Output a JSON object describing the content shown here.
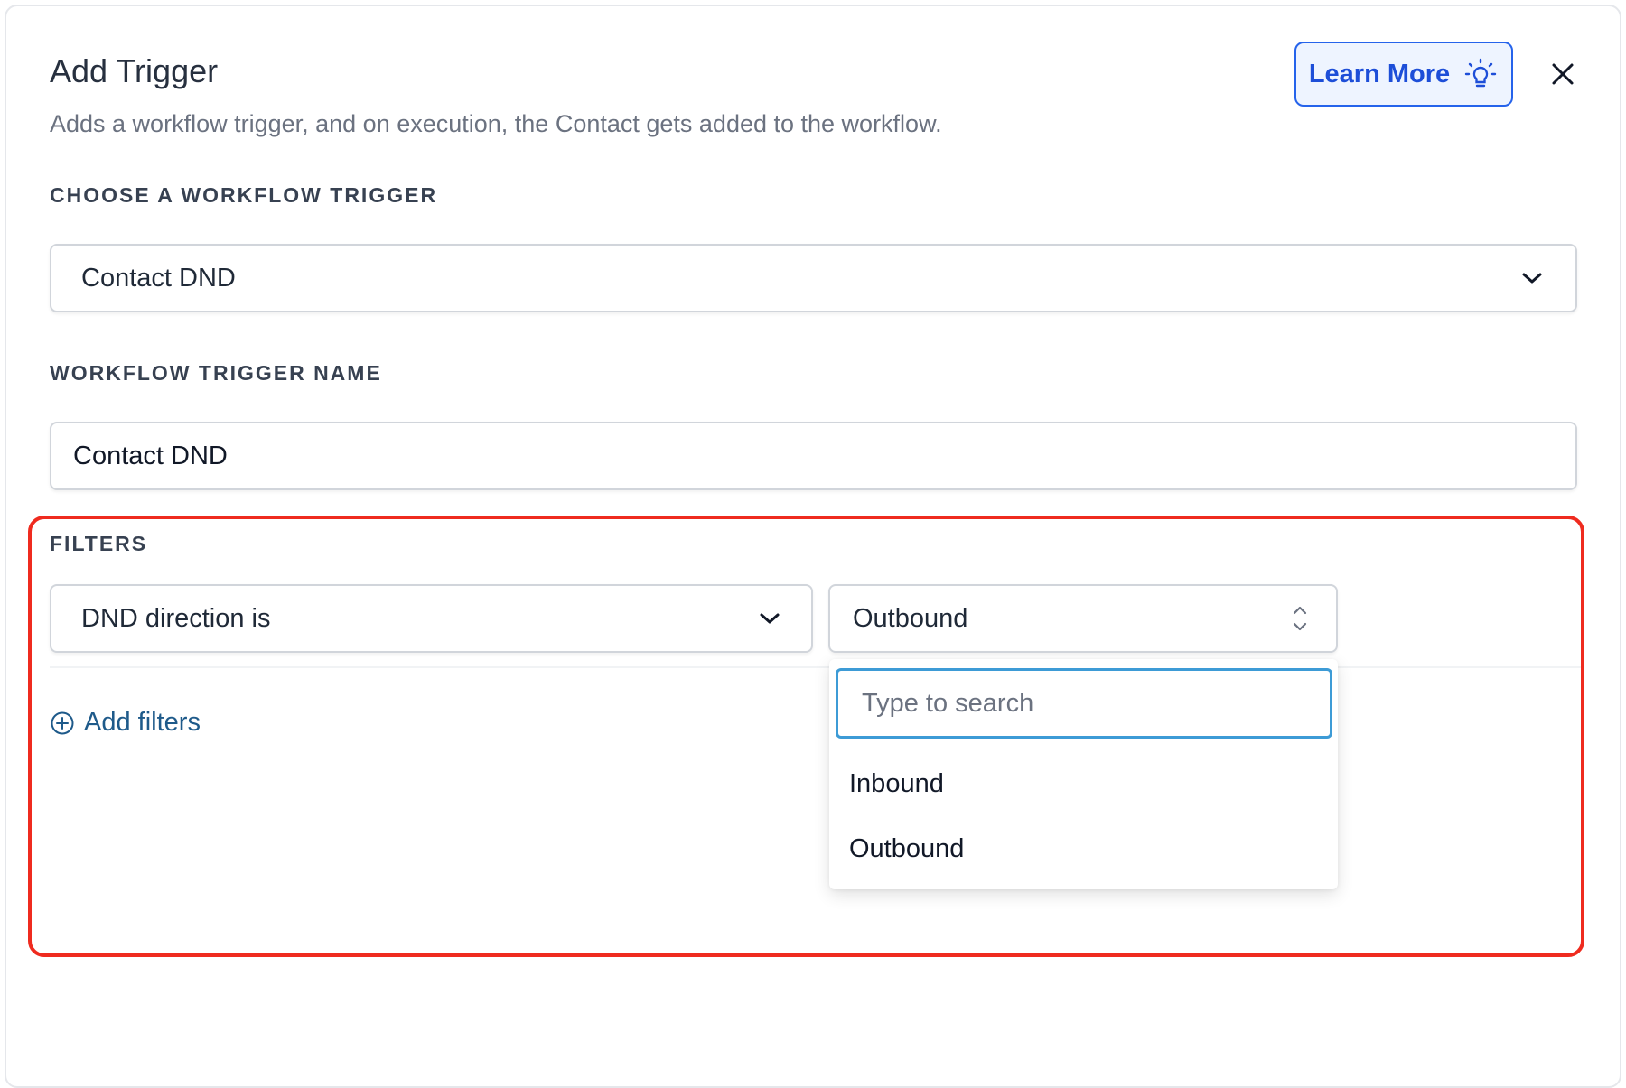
{
  "header": {
    "title": "Add Trigger",
    "subtitle": "Adds a workflow trigger, and on execution, the Contact gets added to the workflow.",
    "learn_more_label": "Learn More",
    "learn_more_icon": "lightbulb-icon",
    "close_icon": "close-icon"
  },
  "trigger": {
    "label": "CHOOSE A WORKFLOW TRIGGER",
    "selected": "Contact DND"
  },
  "trigger_name": {
    "label": "WORKFLOW TRIGGER NAME",
    "value": "Contact DND"
  },
  "filters": {
    "label": "FILTERS",
    "condition": "DND direction is",
    "value": "Outbound",
    "add_label": "Add filters",
    "dropdown": {
      "search_placeholder": "Type to search",
      "options": [
        "Inbound",
        "Outbound"
      ]
    }
  },
  "colors": {
    "accent": "#2563eb",
    "highlight": "#ef2b1f",
    "link": "#1e5a8a",
    "focus": "#3d9bd6"
  }
}
